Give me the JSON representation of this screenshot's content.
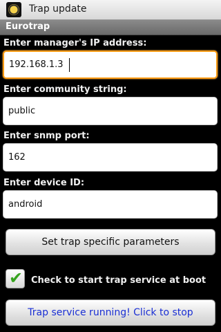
{
  "window": {
    "title": "Trap update",
    "app_icon": "film-reel-icon"
  },
  "header": {
    "section_title": "Eurotrap"
  },
  "form": {
    "manager_ip": {
      "label": "Enter manager's IP address:",
      "value": "192.168.1.3"
    },
    "community": {
      "label": "Enter community string:",
      "value": "public"
    },
    "snmp_port": {
      "label": "Enter snmp port:",
      "value": "162"
    },
    "device_id": {
      "label": "Enter device ID:",
      "value": "android"
    }
  },
  "buttons": {
    "params_label": "Set trap specific parameters",
    "service_label": "Trap service running! Click to stop"
  },
  "boot_option": {
    "label": "Check to start trap service at boot",
    "checked": true,
    "check_symbol": "✔"
  },
  "colors": {
    "focus": "#ff9b12",
    "check": "#36a31e",
    "service_text": "#1a2fd4"
  }
}
